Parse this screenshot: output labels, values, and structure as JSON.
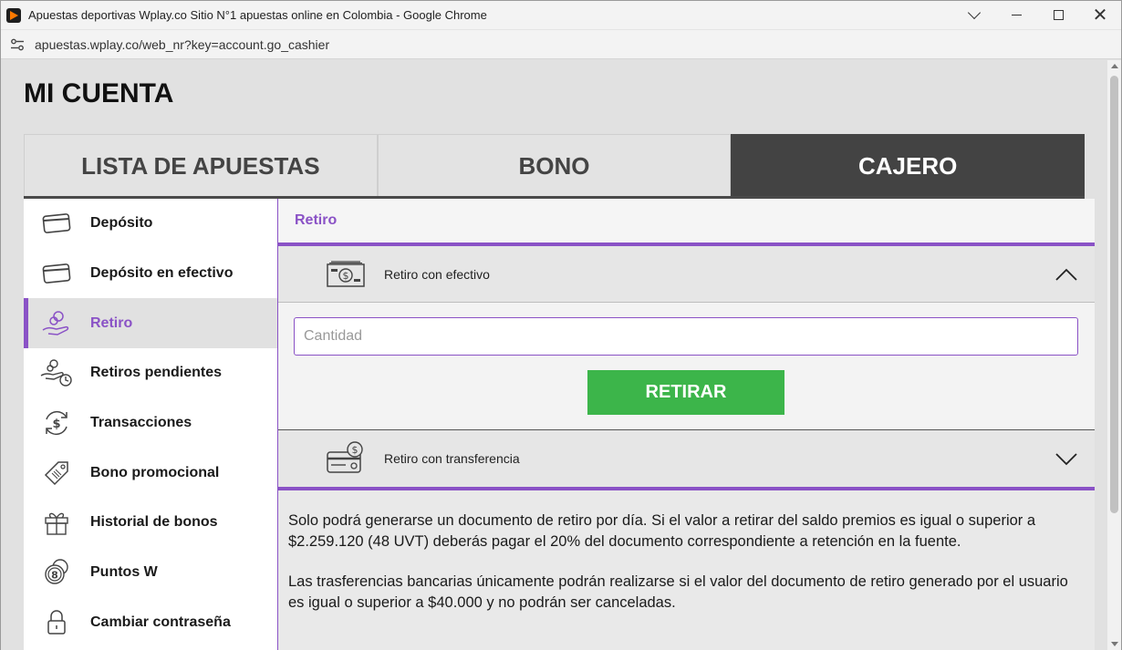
{
  "window": {
    "title": "Apuestas deportivas Wplay.co Sitio N°1 apuestas online en Colombia - Google Chrome",
    "url": "apuestas.wplay.co/web_nr?key=account.go_cashier"
  },
  "page": {
    "title": "MI CUENTA",
    "tabs": [
      {
        "label": "LISTA DE APUESTAS"
      },
      {
        "label": "BONO"
      },
      {
        "label": "CAJERO"
      }
    ],
    "sidebar": [
      {
        "label": "Depósito",
        "icon": "card-icon"
      },
      {
        "label": "Depósito en efectivo",
        "icon": "card-icon"
      },
      {
        "label": "Retiro",
        "icon": "hand-coins-icon"
      },
      {
        "label": "Retiros pendientes",
        "icon": "hand-clock-icon"
      },
      {
        "label": "Transacciones",
        "icon": "refresh-dollar-icon"
      },
      {
        "label": "Bono promocional",
        "icon": "tag-icon"
      },
      {
        "label": "Historial de bonos",
        "icon": "gift-icon"
      },
      {
        "label": "Puntos W",
        "icon": "coins-icon"
      },
      {
        "label": "Cambiar contraseña",
        "icon": "lock-icon"
      }
    ],
    "section_title": "Retiro",
    "cash": {
      "label": "Retiro con efectivo",
      "placeholder": "Cantidad",
      "button": "RETIRAR"
    },
    "transfer": {
      "label": "Retiro con transferencia"
    },
    "info": [
      "Solo podrá generarse un documento de retiro por día. Si el valor a retirar del saldo premios es igual o superior a $2.259.120 (48 UVT) deberás pagar el 20% del documento correspondiente a retención en la fuente.",
      "Las trasferencias bancarias únicamente podrán realizarse si el valor del documento de retiro generado por el usuario es igual o superior a $40.000 y no podrán ser canceladas."
    ]
  },
  "colors": {
    "accent": "#8a52c6",
    "button": "#3cb54a",
    "active_tab": "#434343"
  }
}
